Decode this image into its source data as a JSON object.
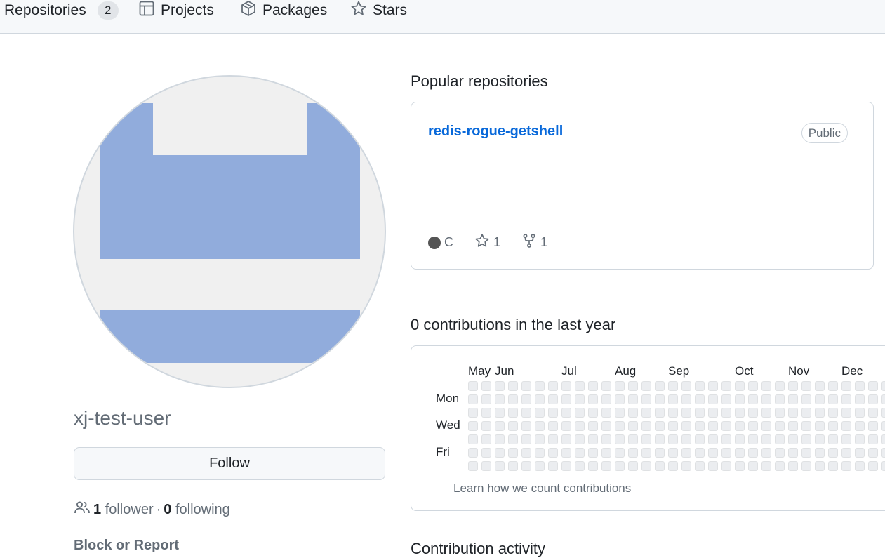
{
  "nav": {
    "tabs": [
      {
        "label": "Repositories",
        "count": "2",
        "icon": "repo-icon"
      },
      {
        "label": "Projects",
        "icon": "table-icon"
      },
      {
        "label": "Packages",
        "icon": "package-icon"
      },
      {
        "label": "Stars",
        "icon": "star-icon"
      }
    ]
  },
  "profile": {
    "username": "xj-test-user",
    "follow_label": "Follow",
    "followers_count": "1",
    "followers_label": "follower",
    "separator": "·",
    "following_count": "0",
    "following_label": "following",
    "block_report": "Block or Report"
  },
  "popular": {
    "title": "Popular repositories",
    "repos": [
      {
        "name": "redis-rogue-getshell",
        "visibility": "Public",
        "language": "C",
        "language_color": "#555555",
        "stars": "1",
        "forks": "1"
      }
    ]
  },
  "contributions": {
    "title": "0 contributions in the last year",
    "months": [
      "May",
      "Jun",
      "Jul",
      "Aug",
      "Sep",
      "Oct",
      "Nov",
      "Dec"
    ],
    "days": [
      "Mon",
      "Wed",
      "Fri"
    ],
    "learn_link": "Learn how we count contributions",
    "cell_color": "#ebedf0"
  },
  "activity": {
    "title": "Contribution activity"
  },
  "colors": {
    "link": "#0969da",
    "muted": "#636c76",
    "border": "#d0d7de",
    "avatar_block": "#91acdc"
  }
}
